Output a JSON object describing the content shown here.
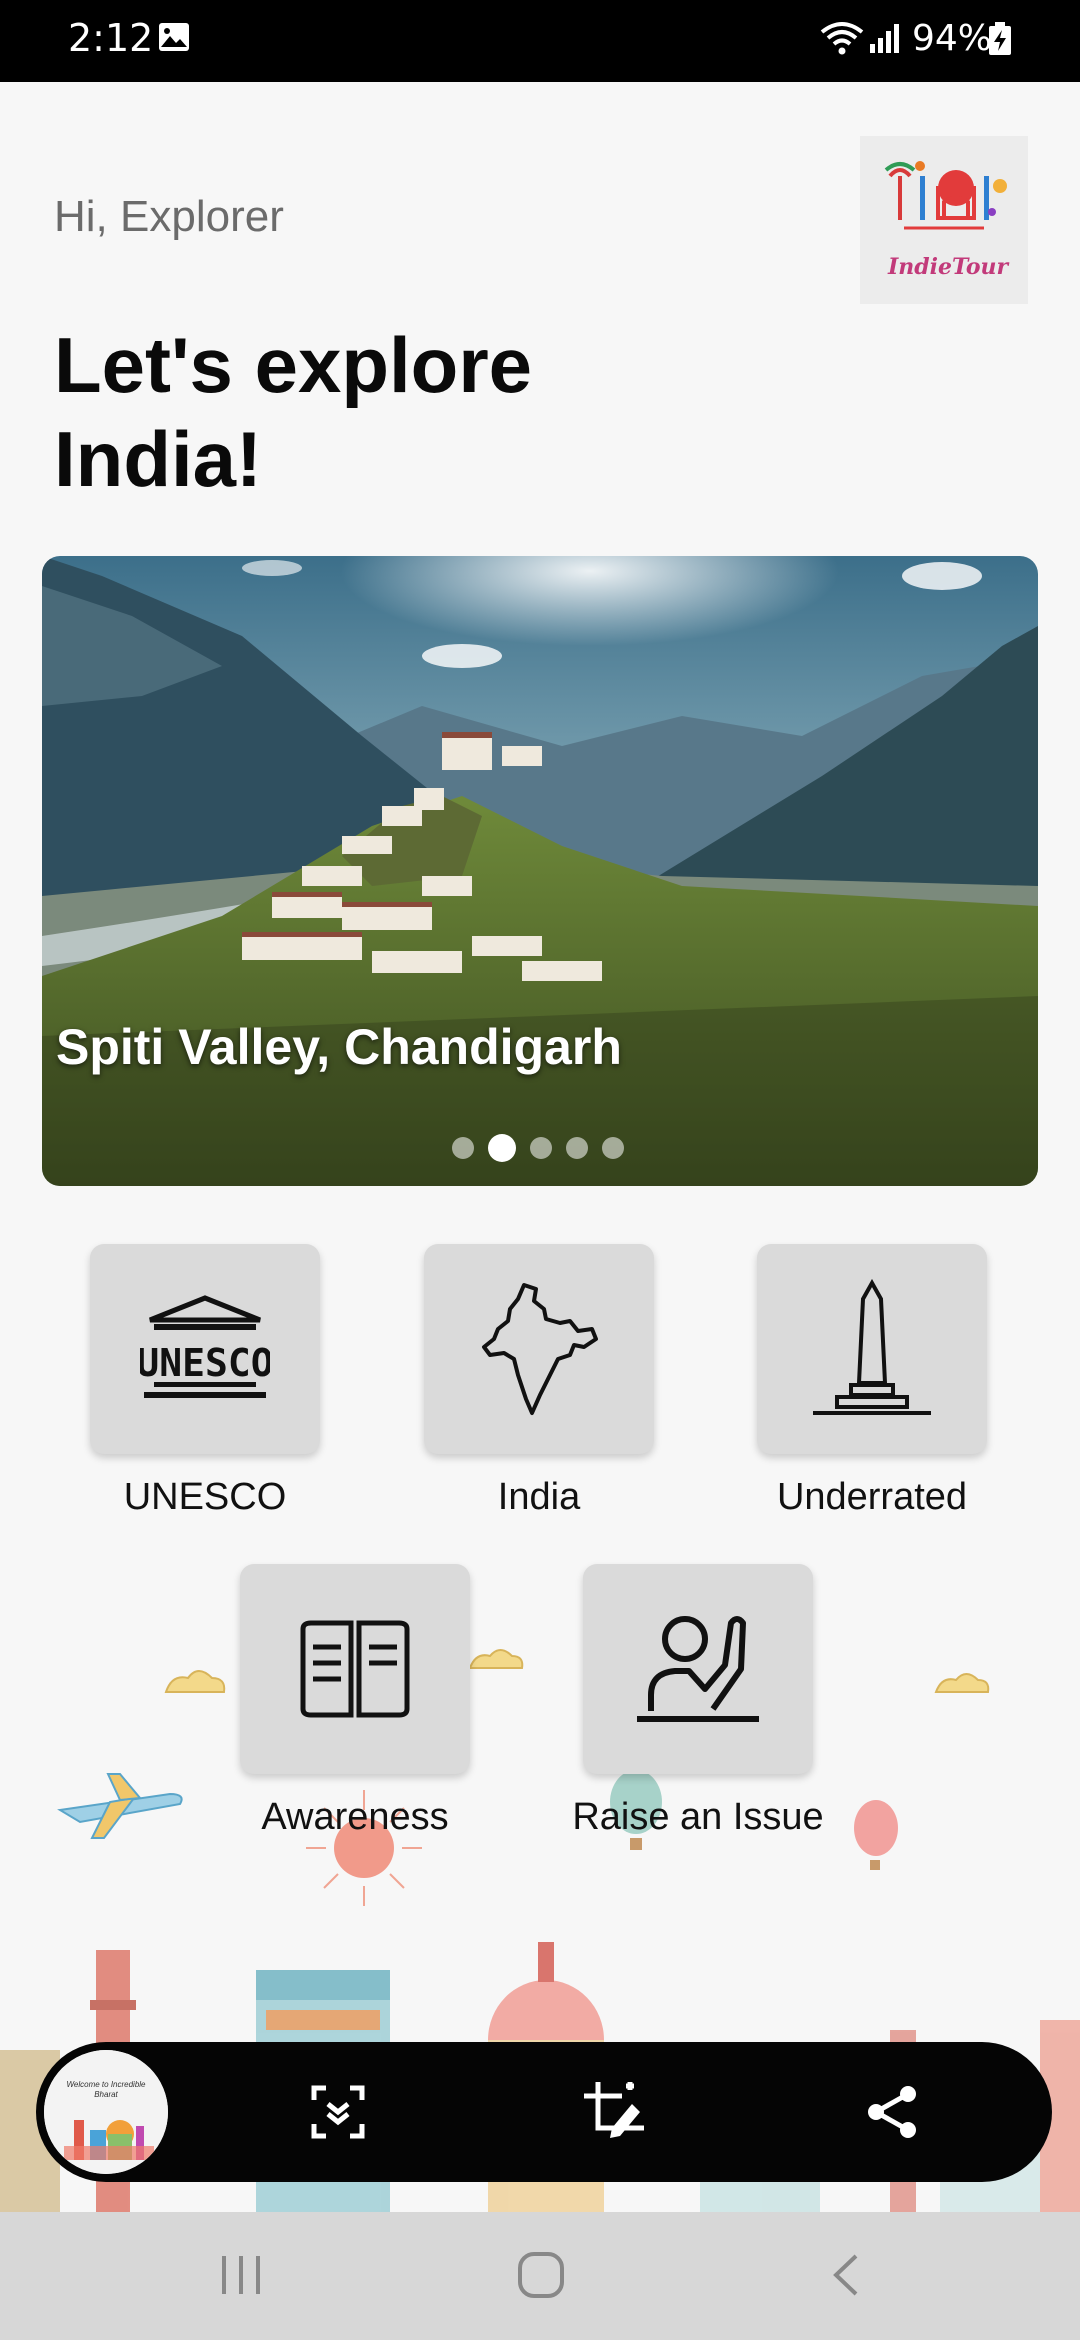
{
  "status_bar": {
    "time": "2:12",
    "battery": "94%"
  },
  "header": {
    "greeting": "Hi, Explorer",
    "headline": "Let's explore India!",
    "logo_text": "IndieTour"
  },
  "carousel": {
    "caption": "Spiti Valley, Chandigarh",
    "slide_count": 5,
    "active_index": 1
  },
  "categories": [
    {
      "label": "UNESCO",
      "icon": "unesco-icon"
    },
    {
      "label": "India",
      "icon": "india-map-icon"
    },
    {
      "label": "Underrated",
      "icon": "monument-icon"
    },
    {
      "label": "Awareness",
      "icon": "book-icon"
    },
    {
      "label": "Raise an Issue",
      "icon": "raise-hand-icon"
    }
  ],
  "bottom_bar": {
    "avatar_text": "Welcome to Incredible Bharat",
    "actions": [
      "scan-icon",
      "crop-edit-icon",
      "share-icon"
    ]
  },
  "colors": {
    "background": "#f7f7f7",
    "tile": "#dadada",
    "bar": "#050505"
  }
}
